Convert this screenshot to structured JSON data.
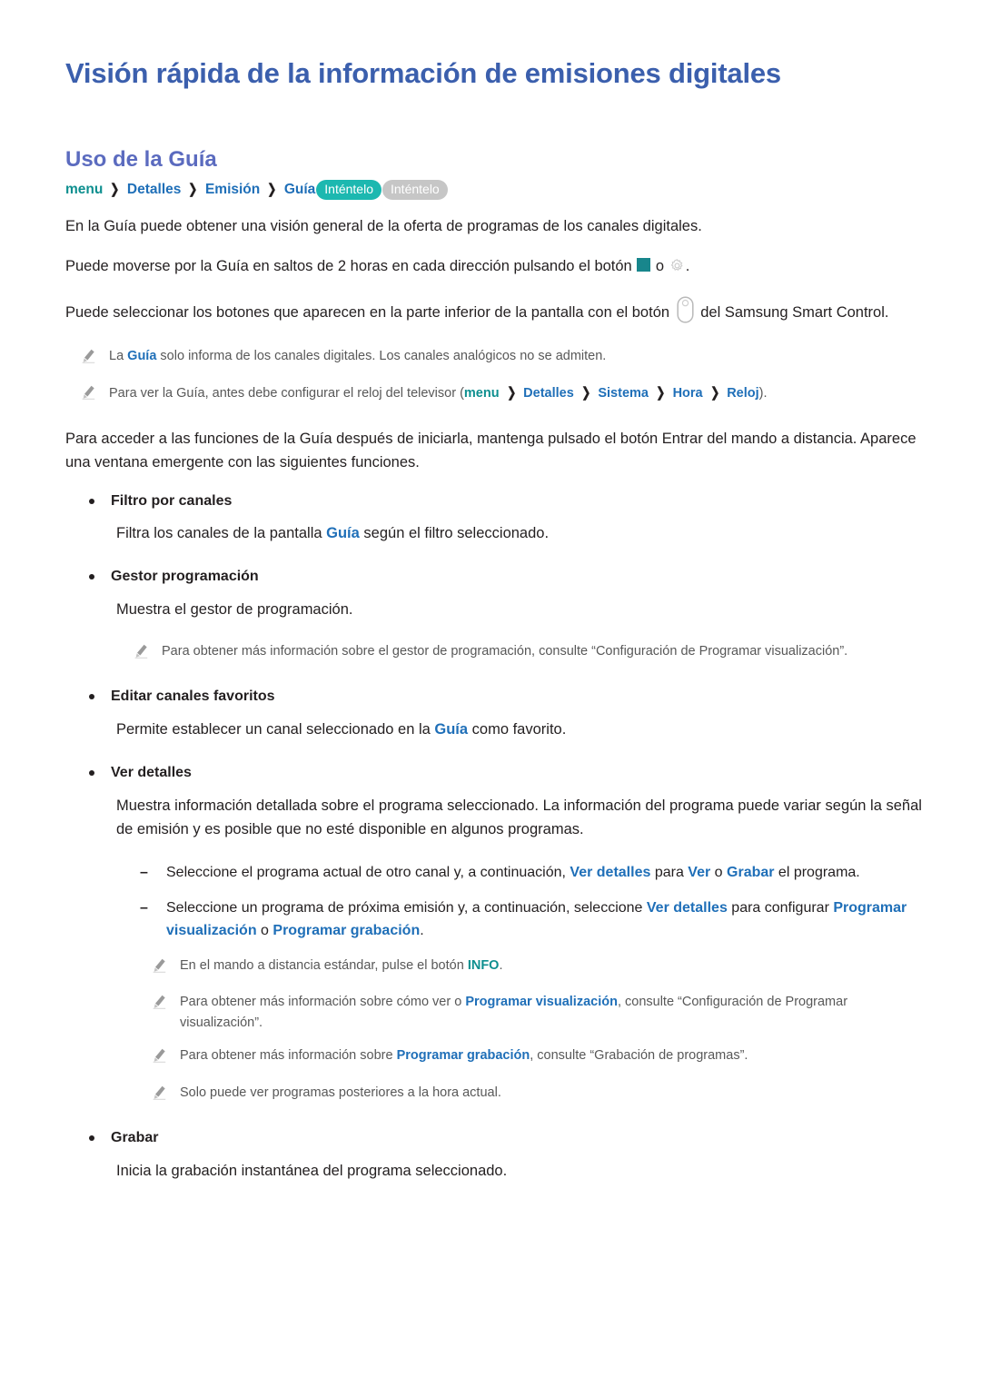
{
  "document": {
    "title": "Visión rápida de la información de emisiones digitales",
    "section_title": "Uso de la Guía"
  },
  "colors": {
    "title_blue": "#3b5fad",
    "section_purple": "#5b6bbf",
    "link_blue": "#1f6fb8",
    "teal": "#0e8f8f",
    "badge_teal": "#1cb8b0",
    "badge_grey": "#c6c6c6",
    "body_text": "#231f20",
    "note_grey": "#585858",
    "square_icon_teal": "#18868c"
  },
  "breadcrumb": {
    "items": [
      {
        "label": "menu",
        "color": "teal"
      },
      {
        "label": "Detalles",
        "color": "blue"
      },
      {
        "label": "Emisión",
        "color": "blue"
      },
      {
        "label": "Guía",
        "color": "blue"
      }
    ],
    "separator": "❯",
    "badges": [
      {
        "label": "Inténtelo",
        "style": "teal"
      },
      {
        "label": "Inténtelo",
        "style": "grey"
      }
    ]
  },
  "intro": {
    "p1": "En la Guía puede obtener una visión general de la oferta de programas de los canales digitales.",
    "p2_before": "Puede moverse por la Guía en saltos de 2 horas en cada dirección pulsando el botón ",
    "p2_between": " o ",
    "p2_after": ".",
    "p3_before": "Puede seleccionar los botones que aparecen en la parte inferior de la pantalla con el botón ",
    "p3_after": " del Samsung Smart Control."
  },
  "notes_top": [
    {
      "before": "La ",
      "bold_blue": "Guía",
      "after": " solo informa de los canales digitales. Los canales analógicos no se admiten."
    }
  ],
  "note_clock": {
    "before": "Para ver la Guía, antes debe configurar el reloj del televisor (",
    "crumbs": [
      {
        "label": "menu",
        "color": "teal"
      },
      {
        "label": "Detalles",
        "color": "blue"
      },
      {
        "label": "Sistema",
        "color": "blue"
      },
      {
        "label": "Hora",
        "color": "blue"
      },
      {
        "label": "Reloj",
        "color": "blue"
      }
    ],
    "after": ")."
  },
  "access_paragraph": "Para acceder a las funciones de la Guía después de iniciarla, mantenga pulsado el botón Entrar del mando a distancia. Aparece una ventana emergente con las siguientes funciones.",
  "features": [
    {
      "label": "Filtro por canales",
      "desc_before": "Filtra los canales de la pantalla ",
      "desc_bold": "Guía",
      "desc_after": " según el filtro seleccionado."
    },
    {
      "label": "Gestor programación",
      "desc": "Muestra el gestor de programación."
    },
    {
      "label": "Editar canales favoritos",
      "desc_before": "Permite establecer un canal seleccionado en la ",
      "desc_bold": "Guía",
      "desc_after": " como favorito."
    },
    {
      "label": "Ver detalles",
      "desc": "Muestra información detallada sobre el programa seleccionado. La información del programa puede variar según la señal de emisión y es posible que no esté disponible en algunos programas."
    },
    {
      "label": "Grabar",
      "desc": "Inicia la grabación instantánea del programa seleccionado."
    }
  ],
  "note_gestor": {
    "text": "Para obtener más información sobre el gestor de programación, consulte “Configuración de Programar visualización”."
  },
  "dash_items": [
    {
      "t1": "Seleccione el programa actual de otro canal y, a continuación, ",
      "b1": "Ver detalles",
      "t2": " para ",
      "b2": "Ver",
      "t3": " o ",
      "b3": "Grabar",
      "t4": " el programa."
    },
    {
      "t1": "Seleccione un programa de próxima emisión y, a continuación, seleccione ",
      "b1": "Ver detalles",
      "t2": " para configurar ",
      "b2": "Programar visualización",
      "t3": " o ",
      "b3": "Programar grabación",
      "t4": "."
    }
  ],
  "notes_bottom": [
    {
      "before": "En el mando a distancia estándar, pulse el botón ",
      "bold": "INFO",
      "bold_color": "teal",
      "after": "."
    },
    {
      "before": "Para obtener más información sobre cómo ver o ",
      "bold": "Programar visualización",
      "bold_color": "blue",
      "after": ", consulte “Configuración de Programar visualización”."
    },
    {
      "before": "Para obtener más información sobre ",
      "bold": "Programar grabación",
      "bold_color": "blue",
      "after": ", consulte “Grabación de programas”."
    },
    {
      "before": "Solo puede ver programas posteriores a la hora actual.",
      "bold": "",
      "bold_color": "blue",
      "after": ""
    }
  ],
  "icons": {
    "square": "colored-square-button-icon",
    "gear": "settings-gear-icon",
    "remote": "smart-control-button-icon",
    "pencil": "pencil-note-icon",
    "chevron": "chevron-right-icon"
  }
}
